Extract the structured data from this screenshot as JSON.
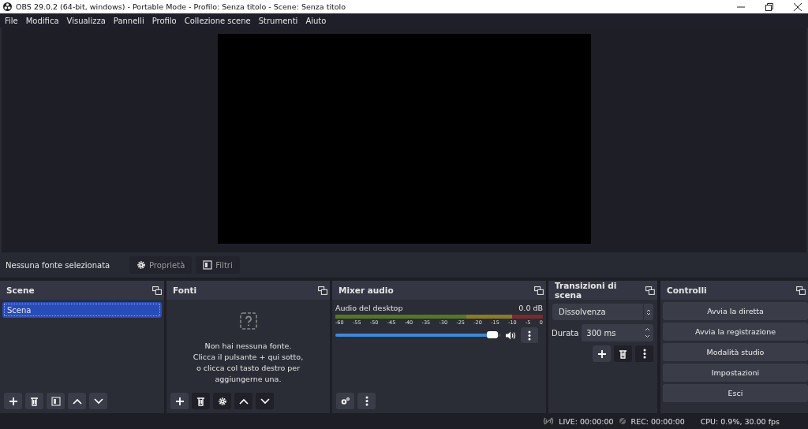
{
  "window": {
    "title": "OBS 29.0.2 (64-bit, windows) - Portable Mode - Profilo: Senza titolo - Scene: Senza titolo"
  },
  "menu": [
    "File",
    "Modifica",
    "Visualizza",
    "Pannelli",
    "Profilo",
    "Collezione scene",
    "Strumenti",
    "Aiuto"
  ],
  "source_toolbar": {
    "label": "Nessuna fonte selezionata",
    "buttons": [
      {
        "kind": "gear",
        "label": "Proprietà",
        "disabled": true
      },
      {
        "kind": "filter",
        "label": "Filtri",
        "disabled": true
      }
    ]
  },
  "scenes": {
    "title": "Scene",
    "items": [
      {
        "label": "Scena",
        "selected": true
      }
    ],
    "toolbar": [
      {
        "kind": "add",
        "disabled": false
      },
      {
        "kind": "remove",
        "disabled": false
      },
      {
        "kind": "filter",
        "disabled": false
      },
      {
        "kind": "up",
        "disabled": false
      },
      {
        "kind": "down",
        "disabled": false
      }
    ]
  },
  "sources": {
    "title": "Fonti",
    "empty_text": "Non hai nessuna fonte.\nClicca il pulsante + qui sotto,\no clicca col tasto destro per\naggiungerne una.",
    "toolbar": [
      {
        "kind": "add",
        "disabled": false
      },
      {
        "kind": "remove",
        "disabled": true
      },
      {
        "kind": "gear",
        "disabled": true
      },
      {
        "kind": "up",
        "disabled": true
      },
      {
        "kind": "down",
        "disabled": true
      }
    ]
  },
  "mixer": {
    "title": "Mixer audio",
    "channels": [
      {
        "name": "Audio del desktop",
        "reading": "0.0 dB",
        "level": 0.98,
        "muted": false
      }
    ],
    "ticks": [
      "-60",
      "-55",
      "-50",
      "-45",
      "-40",
      "-35",
      "-30",
      "-25",
      "-20",
      "-15",
      "-10",
      "-5",
      "0"
    ],
    "toolbar": [
      {
        "kind": "gears",
        "disabled": false
      },
      {
        "kind": "dots",
        "disabled": false
      }
    ]
  },
  "transitions": {
    "title": "Transizioni di scena",
    "transition": "Dissolvenza",
    "duration_label": "Durata",
    "duration": "300 ms",
    "toolbar": [
      {
        "kind": "add",
        "disabled": false
      },
      {
        "kind": "remove",
        "disabled": true
      },
      {
        "kind": "dots",
        "disabled": true
      }
    ]
  },
  "controls": {
    "title": "Controlli",
    "buttons": [
      "Avvia la diretta",
      "Avvia la registrazione",
      "Modalità studio",
      "Impostazioni",
      "Esci"
    ]
  },
  "status_bar": {
    "live": "LIVE: 00:00:00",
    "rec": "REC: 00:00:00",
    "cpu": "CPU: 0.9%, 30.00 fps"
  }
}
